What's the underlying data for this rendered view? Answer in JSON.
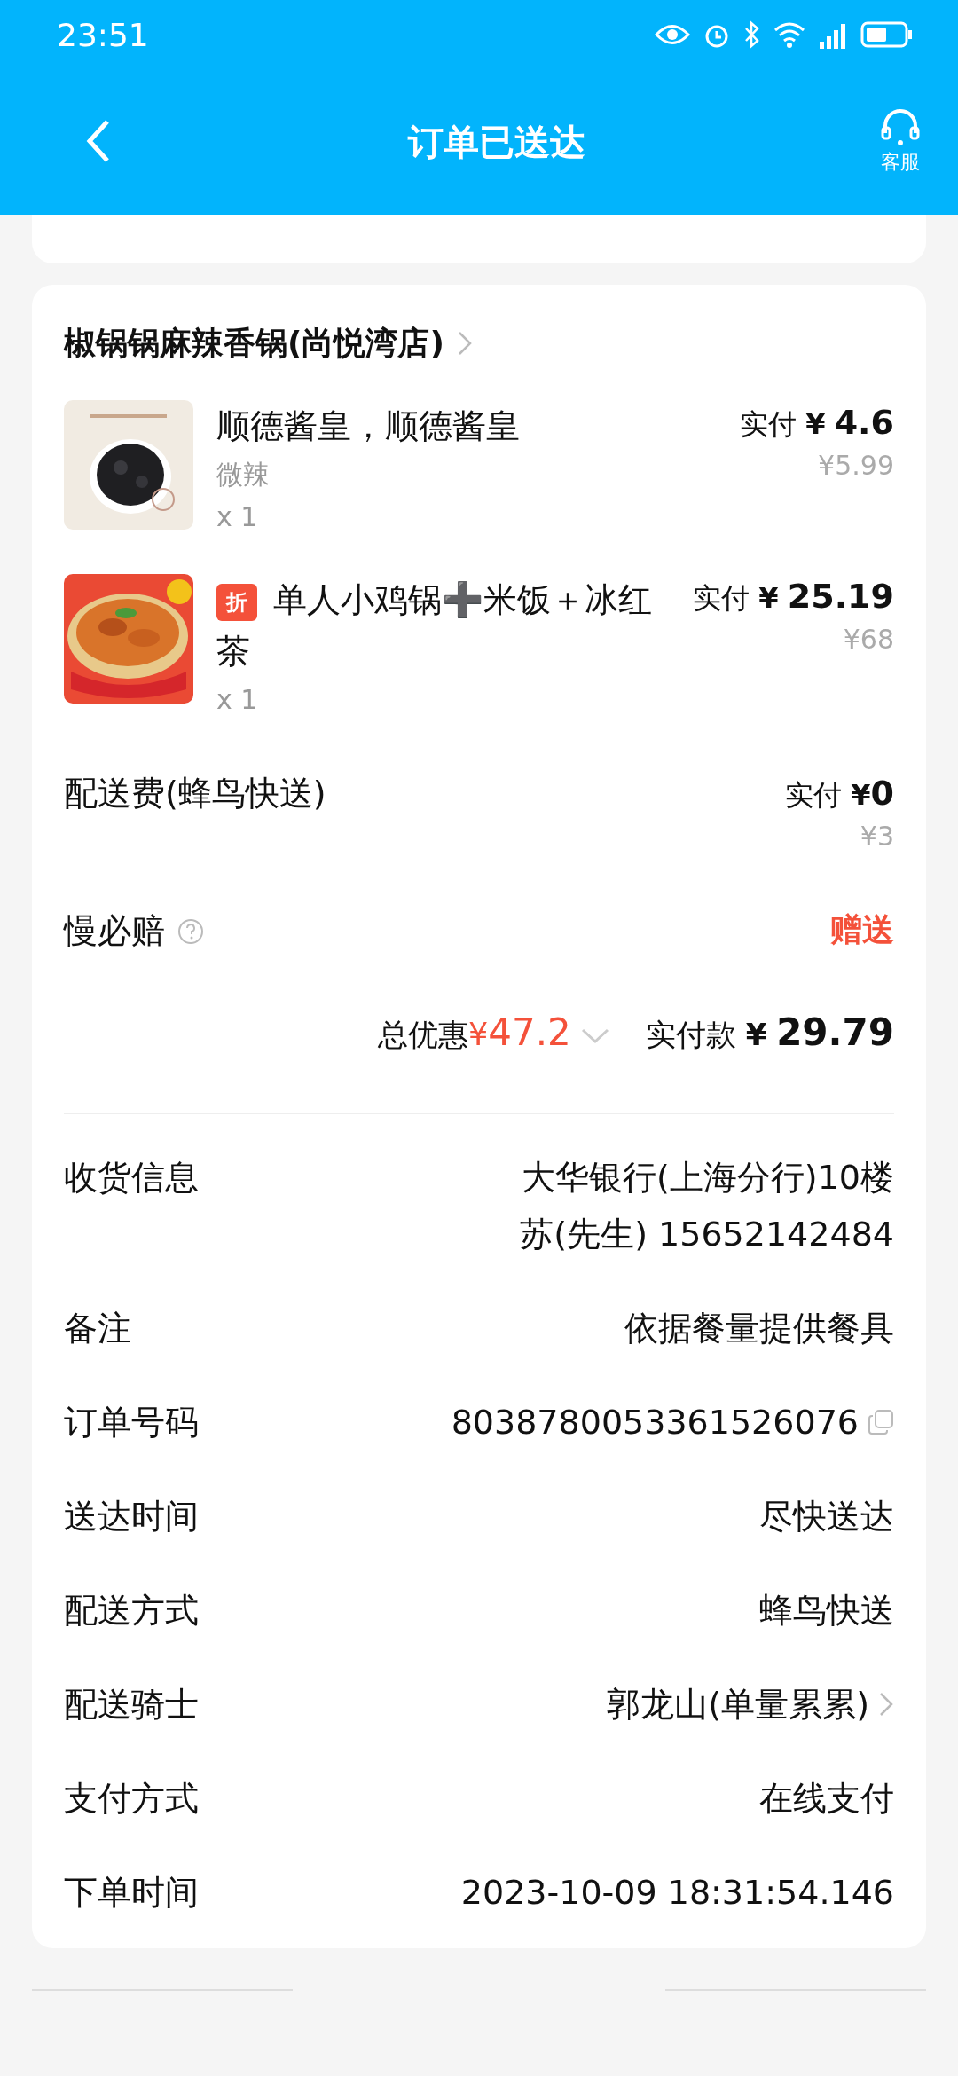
{
  "status_bar": {
    "time": "23:51"
  },
  "header": {
    "title": "订单已送达",
    "service_label": "客服"
  },
  "currency": "¥",
  "store": {
    "name": "椒锅锅麻辣香锅(尚悦湾店)"
  },
  "items": [
    {
      "kind": "plain",
      "name": "顺德酱皇，顺德酱皇",
      "spec": "微辣",
      "qty": "x 1",
      "paid_label": "实付",
      "paid": "4.6",
      "original": "¥5.99"
    },
    {
      "kind": "discount",
      "tag": "折",
      "name": "单人小鸡锅➕米饭＋冰红茶",
      "qty": "x 1",
      "paid_label": "实付",
      "paid": "25.19",
      "original": "¥68"
    }
  ],
  "delivery_fee": {
    "label": "配送费(蜂鸟快送)",
    "paid_label": "实付",
    "paid": "0",
    "original": "¥3"
  },
  "guarantee": {
    "label": "慢必赔",
    "value": "赠送"
  },
  "summary": {
    "discount_label": "总优惠",
    "discount": "47.2",
    "paid_label": "实付款",
    "paid": "29.79"
  },
  "info_rows": [
    {
      "kind": "text",
      "label": "收货信息",
      "lines": [
        "大华银行(上海分行)10楼",
        "苏(先生) 15652142484"
      ]
    },
    {
      "kind": "text",
      "label": "备注",
      "lines": [
        "依据餐量提供餐具"
      ]
    },
    {
      "kind": "copy",
      "label": "订单号码",
      "lines": [
        "8038780053361526076"
      ]
    },
    {
      "kind": "text",
      "label": "送达时间",
      "lines": [
        "尽快送达"
      ]
    },
    {
      "kind": "text",
      "label": "配送方式",
      "lines": [
        "蜂鸟快送"
      ]
    },
    {
      "kind": "link",
      "label": "配送骑士",
      "lines": [
        "郭龙山(单量累累)"
      ]
    },
    {
      "kind": "text",
      "label": "支付方式",
      "lines": [
        "在线支付"
      ]
    },
    {
      "kind": "text",
      "label": "下单时间",
      "lines": [
        "2023-10-09 18:31:54.146"
      ]
    }
  ]
}
